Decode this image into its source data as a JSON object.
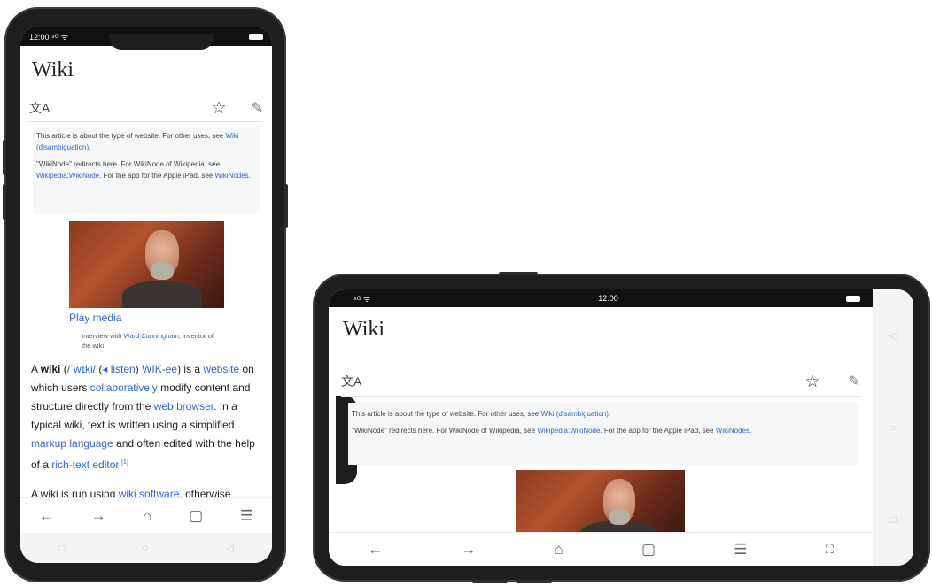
{
  "portrait": {
    "status": {
      "time": "12:00 ⁴ᴳ ᯤ"
    },
    "page_title": "Wiki",
    "hatnote": {
      "p1_text": "This article is about the type of website. For other uses, see ",
      "p1_link": "Wiki (disambiguation)",
      "p2_text_a": "\"WikiNode\" redirects here. For WikiNode of Wikipedia, see ",
      "p2_link_a": "Wikipedia:WikiNode",
      "p2_text_b": ". For the app for the Apple iPad, see ",
      "p2_link_b": "WikiNodes",
      "p2_end": "."
    },
    "media": {
      "play_label": "Play media",
      "caption_a": "Interview with ",
      "caption_link": "Ward Cunningham",
      "caption_b": ", inventor of the wiki"
    },
    "intro": {
      "t1": "A ",
      "bold": "wiki",
      "t2": " (",
      "ipa": "/ˈwɪki/",
      "t3": " (",
      "listen": "◂ listen",
      "t4": ") ",
      "respell": "WIK-ee",
      "t5": ") is a ",
      "website": "website",
      "t6": " on which users ",
      "collab": "collaboratively",
      "t7": " modify content and structure directly from the ",
      "browser": "web browser",
      "t8": ". In a typical wiki, text is written using a simplified ",
      "markup": "markup language",
      "t9": " and often edited with the help of a ",
      "rte": "rich-text editor",
      "t10": ".",
      "ref": "[1]"
    },
    "next_para": {
      "t1": "A wiki is run using ",
      "link": "wiki software",
      "t2": ", otherwise"
    }
  },
  "landscape": {
    "status": {
      "signal": "⁴ᴳ ᯤ",
      "time": "12:00"
    },
    "page_title": "Wiki",
    "hatnote": {
      "p1_text": "This article is about the type of website. For other uses, see ",
      "p1_link": "Wiki (disambiguation)",
      "p1_end": ".",
      "p2_text_a": "\"WikiNode\" redirects here. For WikiNode of Wikipedia, see ",
      "p2_link_a": "Wikipedia:WikiNode",
      "p2_text_b": ". For the app for the Apple iPad, see ",
      "p2_link_b": "WikiNodes",
      "p2_end": "."
    }
  },
  "icons": {
    "translate": "文A",
    "star": "☆",
    "edit": "✎",
    "back": "←",
    "forward": "→",
    "home": "⌂",
    "tabs": "▢",
    "menu": "☰",
    "fullscreen": "⛶",
    "nav_square": "□",
    "nav_circle": "○",
    "nav_triangle": "◁"
  },
  "colors": {
    "link": "#3366cc",
    "frame": "#1d1e20"
  }
}
